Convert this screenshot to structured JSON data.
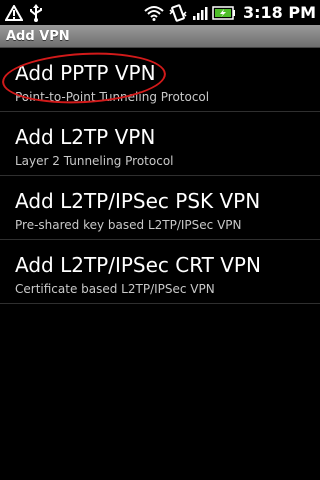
{
  "status_bar": {
    "time": "3:18 PM",
    "icons": [
      "warning-icon",
      "usb-icon",
      "wifi-icon",
      "vibrate-icon",
      "signal-icon",
      "battery-icon"
    ]
  },
  "title_bar": {
    "title": "Add VPN"
  },
  "vpn_options": [
    {
      "title": "Add PPTP VPN",
      "subtitle": "Point-to-Point Tunneling Protocol"
    },
    {
      "title": "Add L2TP VPN",
      "subtitle": "Layer 2 Tunneling Protocol"
    },
    {
      "title": "Add L2TP/IPSec PSK VPN",
      "subtitle": "Pre-shared key based L2TP/IPSec VPN"
    },
    {
      "title": "Add L2TP/IPSec CRT VPN",
      "subtitle": "Certificate based L2TP/IPSec VPN"
    }
  ],
  "colors": {
    "highlight": "#d21a1a",
    "title_bar": "#8a8a8a",
    "background": "#000000"
  }
}
